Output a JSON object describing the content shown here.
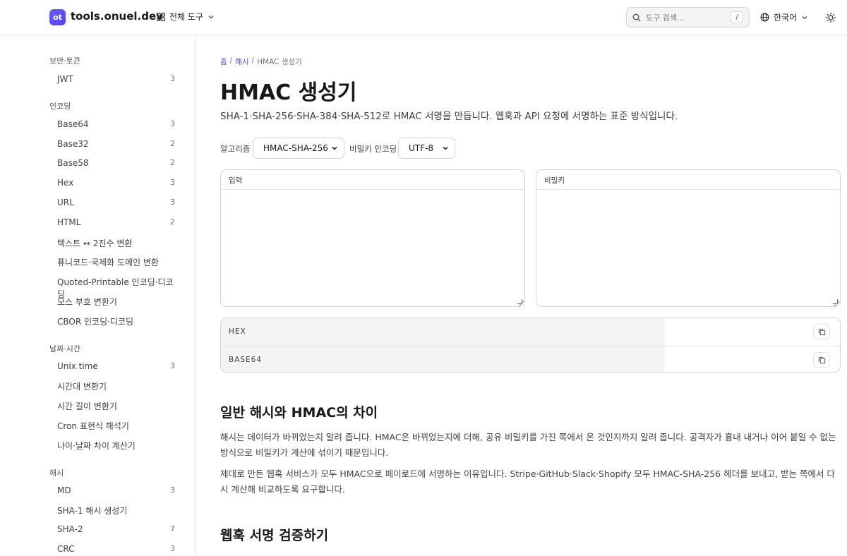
{
  "header": {
    "logo_badge": "ot",
    "site_name": "tools.onuel.dev",
    "all_tools_label": "전체 도구",
    "search_placeholder": "도구 검색...",
    "search_shortcut": "/",
    "language_label": "한국어"
  },
  "sidebar": {
    "groups": [
      {
        "title": "보안·토큰",
        "items": [
          {
            "label": "JWT",
            "count": "3"
          }
        ]
      },
      {
        "title": "인코딩",
        "items": [
          {
            "label": "Base64",
            "count": "3"
          },
          {
            "label": "Base32",
            "count": "2"
          },
          {
            "label": "Base58",
            "count": "2"
          },
          {
            "label": "Hex",
            "count": "3"
          },
          {
            "label": "URL",
            "count": "3"
          },
          {
            "label": "HTML",
            "count": "2"
          },
          {
            "label": "텍스트 ↔ 2진수 변환",
            "count": ""
          },
          {
            "label": "퓨니코드·국제화 도메인 변환",
            "count": ""
          },
          {
            "label": "Quoted-Printable 인코딩·디코딩",
            "count": ""
          },
          {
            "label": "모스 부호 변환기",
            "count": ""
          },
          {
            "label": "CBOR 인코딩·디코딩",
            "count": ""
          }
        ]
      },
      {
        "title": "날짜·시간",
        "items": [
          {
            "label": "Unix time",
            "count": "3"
          },
          {
            "label": "시간대 변환기",
            "count": ""
          },
          {
            "label": "시간 길이 변환기",
            "count": ""
          },
          {
            "label": "Cron 표현식 해석기",
            "count": ""
          },
          {
            "label": "나이·날짜 차이 계산기",
            "count": ""
          }
        ]
      },
      {
        "title": "해시",
        "items": [
          {
            "label": "MD",
            "count": "3"
          },
          {
            "label": "SHA-1 해시 생성기",
            "count": ""
          },
          {
            "label": "SHA-2",
            "count": "7"
          },
          {
            "label": "CRC",
            "count": "3"
          }
        ]
      }
    ]
  },
  "breadcrumb": {
    "home": "홈",
    "category": "해시",
    "current": "HMAC 생성기",
    "separator": "/"
  },
  "page": {
    "title": "HMAC 생성기",
    "subtitle": "SHA-1·SHA-256·SHA-384·SHA-512로 HMAC 서명을 만듭니다. 웹훅과 API 요청에 서명하는 표준 방식입니다."
  },
  "controls": {
    "algorithm_label": "알고리즘",
    "algorithm_value": "HMAC-SHA-256",
    "key_encoding_label": "비밀키 인코딩",
    "key_encoding_value": "UTF-8"
  },
  "inputs": {
    "input_label": "입력",
    "input_value": "",
    "secret_label": "비밀키",
    "secret_value": ""
  },
  "outputs": [
    {
      "label": "HEX",
      "value": ""
    },
    {
      "label": "BASE64",
      "value": ""
    }
  ],
  "article": {
    "section1_title": "일반 해시와 HMAC의 차이",
    "section1_p1": "해시는 데이터가 바뀌었는지 알려 줍니다. HMAC은 바뀌었는지에 더해, 공유 비밀키를 가진 쪽에서 온 것인지까지 알려 줍니다. 공격자가 흉내 내거나 이어 붙일 수 없는 방식으로 비밀키가 계산에 섞이기 때문입니다.",
    "section1_p2": "제대로 만든 웹훅 서비스가 모두 HMAC으로 페이로드에 서명하는 이유입니다. Stripe·GitHub·Slack·Shopify 모두 HMAC-SHA-256 헤더를 보내고, 받는 쪽에서 다시 계산해 비교하도록 요구합니다.",
    "section2_title": "웹훅 서명 검증하기"
  },
  "colors": {
    "accent": "#4f46e5",
    "border": "#d4d4d8",
    "muted_bg": "#f4f4f5"
  },
  "icons": {
    "logo": "ot-badge",
    "grid": "grid-icon",
    "chevron": "chevron-down-icon",
    "search": "search-icon",
    "globe": "globe-icon",
    "theme": "sun-icon",
    "copy": "copy-icon"
  }
}
